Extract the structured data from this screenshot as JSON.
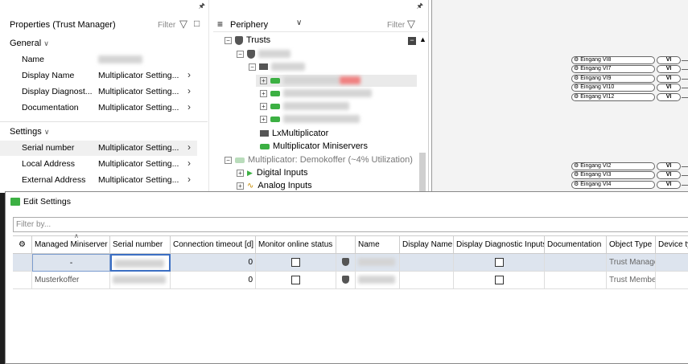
{
  "props": {
    "title": "Properties (Trust Manager)",
    "filter": "Filter",
    "general": "General",
    "settings": "Settings",
    "rows": [
      {
        "k": "Name",
        "v": ""
      },
      {
        "k": "Display Name",
        "v": "Multiplicator Setting..."
      },
      {
        "k": "Display Diagnost...",
        "v": "Multiplicator Setting..."
      },
      {
        "k": "Documentation",
        "v": "Multiplicator Setting..."
      }
    ],
    "srows": [
      {
        "k": "Serial number",
        "v": "Multiplicator Setting..."
      },
      {
        "k": "Local Address",
        "v": "Multiplicator Setting..."
      },
      {
        "k": "External Address",
        "v": "Multiplicator Setting..."
      }
    ]
  },
  "periphery": {
    "title": "Periphery",
    "filter": "Filter",
    "trusts": "Trusts",
    "lxmult": "LxMultiplicator",
    "multms": "Multiplicator Miniservers",
    "demokoffer": "Multiplicator: Demokoffer (~4% Utilization)",
    "digital": "Digital Inputs",
    "analog": "Analog Inputs"
  },
  "signals": {
    "top": [
      "Eingang VI8",
      "Eingang VI7",
      "Eingang VI9",
      "Eingang VI10",
      "Eingang VI12"
    ],
    "bottom": [
      "Eingang VI2",
      "Eingang VI3",
      "Eingang VI4"
    ],
    "tag": "VI"
  },
  "dialog": {
    "title": "Edit Settings",
    "filter_placeholder": "Filter by...",
    "headers": [
      "Managed Miniserver",
      "Serial number",
      "Connection timeout [d]",
      "Monitor online status",
      "",
      "Name",
      "Display Name",
      "Display Diagnostic Inputs",
      "Documentation",
      "Object Type",
      "Device typ"
    ],
    "rows": [
      {
        "managed": "-",
        "timeout": "0",
        "type": "Trust Manager"
      },
      {
        "managed": "Musterkoffer",
        "timeout": "0",
        "type": "Trust Member"
      }
    ]
  },
  "colors": {
    "accent_green": "#3cb043",
    "selection": "#dde4ee"
  }
}
